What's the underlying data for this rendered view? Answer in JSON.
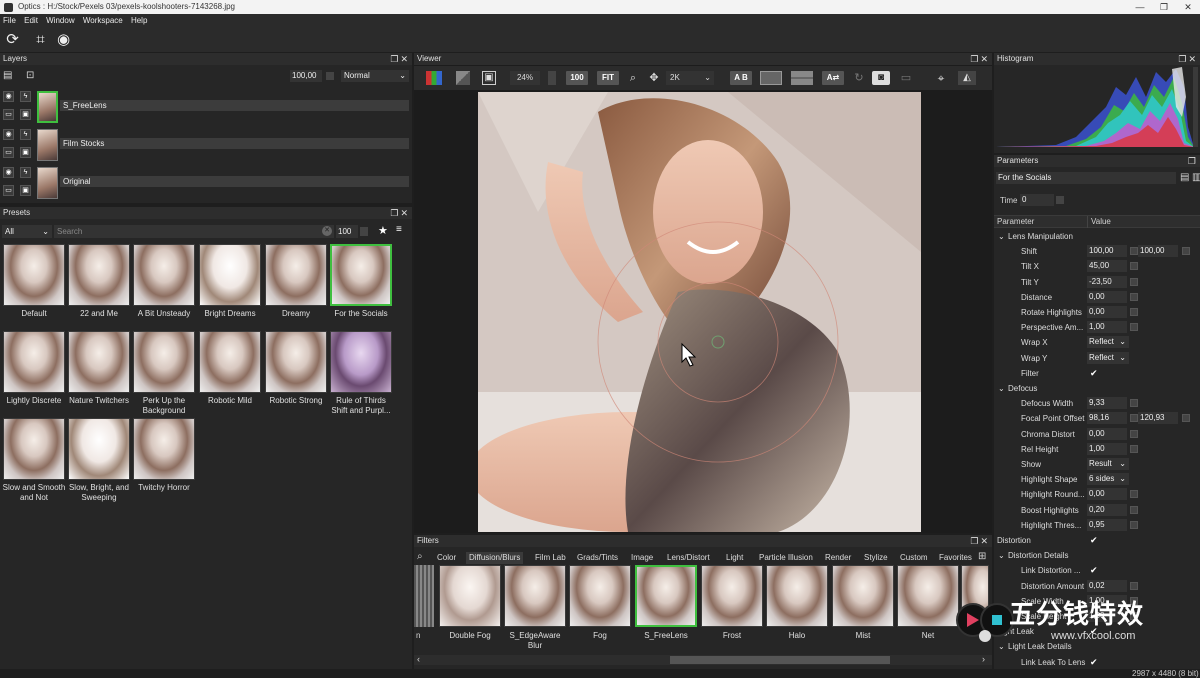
{
  "window": {
    "title": "Optics : H:/Stock/Pexels 03/pexels-koolshooters-7143268.jpg",
    "btn_min": "—",
    "btn_max": "❐",
    "btn_close": "✕"
  },
  "menu": [
    "File",
    "Edit",
    "Window",
    "Workspace",
    "Help"
  ],
  "layers": {
    "title": "Layers",
    "opacity": "100,00",
    "blend_mode": "Normal",
    "items": [
      {
        "name": "S_FreeLens"
      },
      {
        "name": "Film Stocks"
      },
      {
        "name": "Original"
      }
    ]
  },
  "presets": {
    "title": "Presets",
    "filter": "All",
    "search_placeholder": "Search",
    "size": "100",
    "items": [
      {
        "label": "Default"
      },
      {
        "label": "22 and Me"
      },
      {
        "label": "A Bit Unsteady"
      },
      {
        "label": "Bright Dreams"
      },
      {
        "label": "Dreamy"
      },
      {
        "label": "For the Socials"
      },
      {
        "label": "Lightly Discrete"
      },
      {
        "label": "Nature Twitchers"
      },
      {
        "label": "Perk Up the Background"
      },
      {
        "label": "Robotic Mild"
      },
      {
        "label": "Robotic Strong"
      },
      {
        "label": "Rule of Thirds Shift and Purpl..."
      },
      {
        "label": "Slow and Smooth and Not"
      },
      {
        "label": "Slow, Bright, and Sweeping"
      },
      {
        "label": "Twitchy Horror"
      }
    ]
  },
  "viewer": {
    "title": "Viewer",
    "zoom": "24%",
    "btn_100": "100",
    "btn_fit": "FIT",
    "resolution": "2K",
    "btn_ab": "A B"
  },
  "filters": {
    "title": "Filters",
    "tabs": [
      "Color",
      "Diffusion/Blurs",
      "Film Lab",
      "Grads/Tints",
      "Image",
      "Lens/Distort",
      "Light",
      "Particle Illusion",
      "Render",
      "Stylize",
      "Custom",
      "Favorites"
    ],
    "active_tab": "Diffusion/Blurs",
    "partial_label": "n",
    "items": [
      {
        "label": "Double Fog"
      },
      {
        "label": "S_EdgeAware Blur"
      },
      {
        "label": "Fog"
      },
      {
        "label": "S_FreeLens"
      },
      {
        "label": "Frost"
      },
      {
        "label": "Halo"
      },
      {
        "label": "Mist"
      },
      {
        "label": "Net"
      }
    ]
  },
  "histogram": {
    "title": "Histogram"
  },
  "parameters": {
    "title": "Parameters",
    "preset_name": "For the Socials",
    "time_label": "Time",
    "time_value": "0",
    "col_param": "Parameter",
    "col_value": "Value",
    "rows": [
      {
        "name": "Lens Manipulation",
        "group": true
      },
      {
        "name": "Shift",
        "v1": "100,00",
        "v2": "100,00"
      },
      {
        "name": "Tilt X",
        "v1": "45,00"
      },
      {
        "name": "Tilt Y",
        "v1": "-23,50"
      },
      {
        "name": "Distance",
        "v1": "0,00"
      },
      {
        "name": "Rotate Highlights",
        "v1": "0,00"
      },
      {
        "name": "Perspective Am...",
        "v1": "1,00"
      },
      {
        "name": "Wrap X",
        "sel": "Reflect"
      },
      {
        "name": "Wrap Y",
        "sel": "Reflect"
      },
      {
        "name": "Filter",
        "check": "✔"
      },
      {
        "name": "Defocus",
        "group": true
      },
      {
        "name": "Defocus Width",
        "v1": "9,33"
      },
      {
        "name": "Focal Point Offset",
        "v1": "98,16",
        "v2": "120,93"
      },
      {
        "name": "Chroma Distort",
        "v1": "0,00"
      },
      {
        "name": "Rel Height",
        "v1": "1,00"
      },
      {
        "name": "Show",
        "sel": "Result"
      },
      {
        "name": "Highlight Shape",
        "sel": "6 sides"
      },
      {
        "name": "Highlight Round...",
        "v1": "0,00"
      },
      {
        "name": "Boost Highlights",
        "v1": "0,20"
      },
      {
        "name": "Highlight Thres...",
        "v1": "0,95"
      },
      {
        "name": "Distortion",
        "check": "✔",
        "top": true
      },
      {
        "name": "Distortion Details",
        "group": true
      },
      {
        "name": "Link Distortion ...",
        "check": "✔"
      },
      {
        "name": "Distortion Amount",
        "v1": "0,02"
      },
      {
        "name": "Scale Width",
        "v1": "1,00"
      },
      {
        "name": "Scale Height",
        "v1": "1,00"
      },
      {
        "name": "Light Leak",
        "check": "✔",
        "top": true
      },
      {
        "name": "Light Leak Details",
        "group": true
      },
      {
        "name": "Link Leak To Lens",
        "check": "✔"
      }
    ]
  },
  "status": {
    "dimensions": "2987 x 4480 (8 bit)"
  },
  "watermark": {
    "text": "五分钱特效",
    "url": "www.vfxcool.com"
  }
}
